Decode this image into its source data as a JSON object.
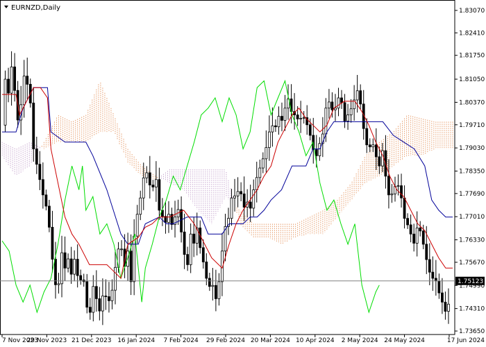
{
  "chart_data": {
    "type": "candlestick",
    "title": "EURNZD,Daily",
    "ylim": [
      1.7365,
      1.8307
    ],
    "y_ticks": [
      1.8307,
      1.8241,
      1.8175,
      1.8105,
      1.8037,
      1.7971,
      1.7903,
      1.7835,
      1.7769,
      1.7701,
      1.7633,
      1.7567,
      1.7499,
      1.7431,
      1.7365
    ],
    "y_tick_labels": [
      "1.83070",
      "1.82410",
      "1.81750",
      "1.81050",
      "1.80370",
      "1.79710",
      "1.79030",
      "1.78350",
      "1.77690",
      "1.77010",
      "1.76330",
      "1.75670",
      "1.74990",
      "1.74310",
      "1.73650"
    ],
    "x_labels": [
      "7 Nov 2023",
      "29 Nov 2023",
      "21 Dec 2023",
      "16 Jan 2024",
      "7 Feb 2024",
      "29 Feb 2024",
      "20 Mar 2024",
      "10 Apr 2024",
      "2 May 2024",
      "24 May 2024",
      "17 Jun 2024"
    ],
    "current_price": 1.75123,
    "current_price_label": "1.75123",
    "grid": false,
    "colors": {
      "candle": "#000000",
      "tenkan": "#cc0000",
      "kijun": "#000099",
      "chikou": "#00dd00",
      "cloud_bull": "#e8a070",
      "cloud_bear": "#c8a8d0",
      "price_line": "#808080",
      "price_tag_bg": "#000000"
    },
    "close_path": [
      [
        0,
        1.797
      ],
      [
        5,
        1.812
      ],
      [
        10,
        1.805
      ],
      [
        15,
        1.818
      ],
      [
        20,
        1.8
      ],
      [
        25,
        1.797
      ],
      [
        30,
        1.812
      ],
      [
        35,
        1.81
      ],
      [
        40,
        1.805
      ],
      [
        45,
        1.79
      ],
      [
        50,
        1.785
      ],
      [
        55,
        1.78
      ],
      [
        60,
        1.775
      ],
      [
        65,
        1.772
      ],
      [
        70,
        1.762
      ],
      [
        75,
        1.751
      ],
      [
        80,
        1.748
      ],
      [
        85,
        1.76
      ],
      [
        90,
        1.755
      ],
      [
        95,
        1.758
      ],
      [
        100,
        1.752
      ],
      [
        105,
        1.76
      ],
      [
        110,
        1.748
      ],
      [
        115,
        1.755
      ],
      [
        120,
        1.745
      ],
      [
        125,
        1.74
      ],
      [
        130,
        1.75
      ],
      [
        135,
        1.746
      ],
      [
        140,
        1.742
      ],
      [
        145,
        1.748
      ],
      [
        150,
        1.746
      ],
      [
        155,
        1.745
      ],
      [
        160,
        1.752
      ],
      [
        165,
        1.76
      ],
      [
        170,
        1.762
      ],
      [
        175,
        1.755
      ],
      [
        180,
        1.76
      ],
      [
        185,
        1.75
      ],
      [
        190,
        1.768
      ],
      [
        195,
        1.772
      ],
      [
        200,
        1.778
      ],
      [
        205,
        1.785
      ],
      [
        210,
        1.78
      ],
      [
        215,
        1.778
      ],
      [
        220,
        1.782
      ],
      [
        225,
        1.772
      ],
      [
        230,
        1.77
      ],
      [
        235,
        1.768
      ],
      [
        240,
        1.772
      ],
      [
        245,
        1.765
      ],
      [
        250,
        1.775
      ],
      [
        255,
        1.768
      ],
      [
        260,
        1.76
      ],
      [
        265,
        1.755
      ],
      [
        270,
        1.765
      ],
      [
        275,
        1.762
      ],
      [
        280,
        1.768
      ],
      [
        285,
        1.758
      ],
      [
        290,
        1.756
      ],
      [
        295,
        1.748
      ],
      [
        300,
        1.752
      ],
      [
        305,
        1.745
      ],
      [
        310,
        1.75
      ],
      [
        315,
        1.76
      ],
      [
        320,
        1.768
      ],
      [
        325,
        1.77
      ],
      [
        330,
        1.778
      ],
      [
        335,
        1.775
      ],
      [
        340,
        1.78
      ],
      [
        345,
        1.772
      ],
      [
        350,
        1.775
      ],
      [
        355,
        1.772
      ],
      [
        360,
        1.778
      ],
      [
        365,
        1.782
      ],
      [
        370,
        1.785
      ],
      [
        375,
        1.788
      ],
      [
        380,
        1.792
      ],
      [
        385,
        1.798
      ],
      [
        390,
        1.795
      ],
      [
        395,
        1.8
      ],
      [
        400,
        1.798
      ],
      [
        405,
        1.802
      ],
      [
        410,
        1.805
      ],
      [
        415,
        1.8
      ],
      [
        420,
        1.8
      ],
      [
        425,
        1.798
      ],
      [
        430,
        1.8
      ],
      [
        435,
        1.798
      ],
      [
        440,
        1.795
      ],
      [
        445,
        1.79
      ],
      [
        450,
        1.788
      ],
      [
        455,
        1.792
      ],
      [
        460,
        1.795
      ],
      [
        465,
        1.805
      ],
      [
        470,
        1.803
      ],
      [
        475,
        1.8
      ],
      [
        480,
        1.805
      ],
      [
        485,
        1.805
      ],
      [
        490,
        1.798
      ],
      [
        495,
        1.8
      ],
      [
        500,
        1.802
      ],
      [
        505,
        1.805
      ],
      [
        510,
        1.808
      ],
      [
        515,
        1.8
      ],
      [
        520,
        1.792
      ],
      [
        525,
        1.79
      ],
      [
        530,
        1.792
      ],
      [
        535,
        1.788
      ],
      [
        540,
        1.785
      ],
      [
        545,
        1.79
      ],
      [
        550,
        1.78
      ],
      [
        555,
        1.775
      ],
      [
        560,
        1.778
      ],
      [
        565,
        1.78
      ],
      [
        570,
        1.778
      ],
      [
        575,
        1.77
      ],
      [
        580,
        1.768
      ],
      [
        585,
        1.765
      ],
      [
        590,
        1.762
      ],
      [
        595,
        1.768
      ],
      [
        600,
        1.765
      ],
      [
        605,
        1.76
      ],
      [
        610,
        1.755
      ],
      [
        615,
        1.752
      ],
      [
        620,
        1.752
      ],
      [
        625,
        1.748
      ],
      [
        630,
        1.745
      ],
      [
        635,
        1.742
      ],
      [
        640,
        1.745
      ]
    ],
    "tenkan": [
      [
        0,
        1.806
      ],
      [
        20,
        1.806
      ],
      [
        25,
        1.8
      ],
      [
        45,
        1.808
      ],
      [
        55,
        1.808
      ],
      [
        65,
        1.805
      ],
      [
        70,
        1.79
      ],
      [
        80,
        1.78
      ],
      [
        90,
        1.77
      ],
      [
        100,
        1.765
      ],
      [
        110,
        1.762
      ],
      [
        125,
        1.756
      ],
      [
        150,
        1.756
      ],
      [
        155,
        1.755
      ],
      [
        170,
        1.752
      ],
      [
        180,
        1.762
      ],
      [
        195,
        1.764
      ],
      [
        205,
        1.767
      ],
      [
        215,
        1.768
      ],
      [
        225,
        1.77
      ],
      [
        240,
        1.77
      ],
      [
        260,
        1.772
      ],
      [
        275,
        1.768
      ],
      [
        290,
        1.762
      ],
      [
        300,
        1.758
      ],
      [
        315,
        1.755
      ],
      [
        325,
        1.762
      ],
      [
        335,
        1.768
      ],
      [
        345,
        1.772
      ],
      [
        355,
        1.775
      ],
      [
        365,
        1.778
      ],
      [
        375,
        1.782
      ],
      [
        385,
        1.785
      ],
      [
        395,
        1.792
      ],
      [
        405,
        1.796
      ],
      [
        415,
        1.8
      ],
      [
        425,
        1.802
      ],
      [
        435,
        1.799
      ],
      [
        445,
        1.797
      ],
      [
        455,
        1.795
      ],
      [
        465,
        1.797
      ],
      [
        475,
        1.802
      ],
      [
        490,
        1.804
      ],
      [
        505,
        1.804
      ],
      [
        515,
        1.801
      ],
      [
        525,
        1.797
      ],
      [
        535,
        1.792
      ],
      [
        545,
        1.788
      ],
      [
        555,
        1.782
      ],
      [
        565,
        1.778
      ],
      [
        575,
        1.776
      ],
      [
        585,
        1.772
      ],
      [
        595,
        1.768
      ],
      [
        605,
        1.766
      ],
      [
        615,
        1.762
      ],
      [
        625,
        1.758
      ],
      [
        635,
        1.755
      ],
      [
        645,
        1.755
      ]
    ],
    "kijun": [
      [
        0,
        1.795
      ],
      [
        20,
        1.795
      ],
      [
        30,
        1.802
      ],
      [
        45,
        1.808
      ],
      [
        65,
        1.808
      ],
      [
        70,
        1.795
      ],
      [
        90,
        1.792
      ],
      [
        120,
        1.792
      ],
      [
        130,
        1.788
      ],
      [
        150,
        1.778
      ],
      [
        170,
        1.765
      ],
      [
        180,
        1.762
      ],
      [
        195,
        1.762
      ],
      [
        205,
        1.768
      ],
      [
        225,
        1.77
      ],
      [
        235,
        1.768
      ],
      [
        245,
        1.768
      ],
      [
        265,
        1.77
      ],
      [
        285,
        1.77
      ],
      [
        295,
        1.765
      ],
      [
        315,
        1.765
      ],
      [
        325,
        1.768
      ],
      [
        345,
        1.768
      ],
      [
        355,
        1.77
      ],
      [
        365,
        1.77
      ],
      [
        375,
        1.772
      ],
      [
        385,
        1.775
      ],
      [
        400,
        1.778
      ],
      [
        415,
        1.785
      ],
      [
        425,
        1.785
      ],
      [
        435,
        1.785
      ],
      [
        445,
        1.79
      ],
      [
        455,
        1.79
      ],
      [
        465,
        1.795
      ],
      [
        475,
        1.798
      ],
      [
        490,
        1.798
      ],
      [
        505,
        1.798
      ],
      [
        515,
        1.798
      ],
      [
        530,
        1.798
      ],
      [
        545,
        1.798
      ],
      [
        560,
        1.794
      ],
      [
        575,
        1.792
      ],
      [
        590,
        1.79
      ],
      [
        605,
        1.785
      ],
      [
        615,
        1.775
      ],
      [
        625,
        1.772
      ],
      [
        635,
        1.77
      ],
      [
        645,
        1.77
      ]
    ],
    "chikou": [
      [
        0,
        1.763
      ],
      [
        10,
        1.76
      ],
      [
        20,
        1.75
      ],
      [
        30,
        1.745
      ],
      [
        40,
        1.75
      ],
      [
        50,
        1.742
      ],
      [
        60,
        1.748
      ],
      [
        70,
        1.752
      ],
      [
        80,
        1.762
      ],
      [
        90,
        1.775
      ],
      [
        100,
        1.785
      ],
      [
        110,
        1.778
      ],
      [
        115,
        1.785
      ],
      [
        120,
        1.772
      ],
      [
        130,
        1.776
      ],
      [
        140,
        1.765
      ],
      [
        150,
        1.768
      ],
      [
        160,
        1.762
      ],
      [
        170,
        1.752
      ],
      [
        180,
        1.758
      ],
      [
        190,
        1.765
      ],
      [
        200,
        1.745
      ],
      [
        205,
        1.755
      ],
      [
        215,
        1.762
      ],
      [
        225,
        1.77
      ],
      [
        235,
        1.775
      ],
      [
        245,
        1.782
      ],
      [
        255,
        1.778
      ],
      [
        265,
        1.785
      ],
      [
        275,
        1.792
      ],
      [
        285,
        1.8
      ],
      [
        295,
        1.802
      ],
      [
        305,
        1.805
      ],
      [
        315,
        1.798
      ],
      [
        325,
        1.805
      ],
      [
        335,
        1.8
      ],
      [
        345,
        1.79
      ],
      [
        355,
        1.795
      ],
      [
        365,
        1.808
      ],
      [
        375,
        1.81
      ],
      [
        385,
        1.8
      ],
      [
        395,
        1.805
      ],
      [
        405,
        1.81
      ],
      [
        415,
        1.8
      ],
      [
        425,
        1.795
      ],
      [
        435,
        1.788
      ],
      [
        445,
        1.792
      ],
      [
        455,
        1.78
      ],
      [
        465,
        1.772
      ],
      [
        475,
        1.775
      ],
      [
        485,
        1.768
      ],
      [
        495,
        1.762
      ],
      [
        505,
        1.768
      ],
      [
        515,
        1.75
      ],
      [
        525,
        1.742
      ],
      [
        535,
        1.748
      ],
      [
        540,
        1.75
      ]
    ],
    "cloud": [
      [
        0,
        1.788,
        1.792
      ],
      [
        20,
        1.782,
        1.79
      ],
      [
        40,
        1.785,
        1.792
      ],
      [
        60,
        1.792,
        1.79
      ],
      [
        80,
        1.8,
        1.792
      ],
      [
        100,
        1.798,
        1.792
      ],
      [
        120,
        1.8,
        1.792
      ],
      [
        140,
        1.81,
        1.795
      ],
      [
        160,
        1.8,
        1.795
      ],
      [
        180,
        1.79,
        1.786
      ],
      [
        200,
        1.785,
        1.782
      ],
      [
        220,
        1.782,
        1.781
      ],
      [
        240,
        1.78,
        1.784
      ],
      [
        260,
        1.778,
        1.784
      ],
      [
        280,
        1.772,
        1.784
      ],
      [
        300,
        1.768,
        1.784
      ],
      [
        320,
        1.776,
        1.784
      ],
      [
        340,
        1.772,
        1.768
      ],
      [
        360,
        1.768,
        1.764
      ],
      [
        380,
        1.768,
        1.764
      ],
      [
        400,
        1.768,
        1.762
      ],
      [
        420,
        1.768,
        1.764
      ],
      [
        440,
        1.77,
        1.765
      ],
      [
        460,
        1.772,
        1.765
      ],
      [
        480,
        1.775,
        1.77
      ],
      [
        500,
        1.78,
        1.775
      ],
      [
        520,
        1.788,
        1.78
      ],
      [
        540,
        1.792,
        1.782
      ],
      [
        560,
        1.795,
        1.785
      ],
      [
        580,
        1.8,
        1.788
      ],
      [
        600,
        1.799,
        1.788
      ],
      [
        620,
        1.798,
        1.79
      ],
      [
        645,
        1.798,
        1.79
      ]
    ]
  }
}
